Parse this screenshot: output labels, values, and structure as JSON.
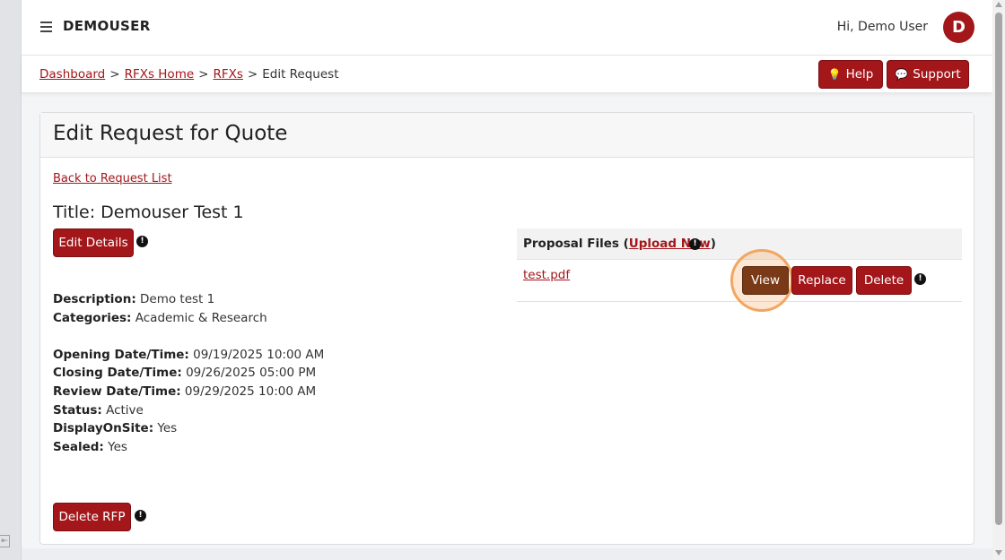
{
  "topbar": {
    "brand": "DEMOUSER",
    "greeting": "Hi, Demo User",
    "avatar_initial": "D"
  },
  "breadcrumb": {
    "items": [
      "Dashboard",
      "RFXs Home",
      "RFXs"
    ],
    "separator": ">",
    "current": "Edit Request"
  },
  "header_buttons": {
    "help_label": "Help",
    "support_label": "Support"
  },
  "card": {
    "title": "Edit Request for Quote",
    "back_link": "Back to Request List",
    "request_title": "Title: Demouser Test 1",
    "edit_details_label": "Edit Details",
    "delete_rfp_label": "Delete RFP"
  },
  "details": {
    "description_label": "Description:",
    "description": "Demo test 1",
    "categories_label": "Categories:",
    "categories": "Academic & Research",
    "opening_label": "Opening Date/Time:",
    "opening": "09/19/2025 10:00 AM",
    "closing_label": "Closing Date/Time:",
    "closing": "09/26/2025 05:00 PM",
    "review_label": "Review Date/Time:",
    "review": "09/29/2025 10:00 AM",
    "status_label": "Status:",
    "status": "Active",
    "display_label": "DisplayOnSite:",
    "display": "Yes",
    "sealed_label": "Sealed:",
    "sealed": "Yes"
  },
  "proposal_files": {
    "heading_prefix": "Proposal Files (",
    "upload_link": "Upload New",
    "heading_suffix": ")",
    "files": [
      {
        "name": "test.pdf",
        "view_label": "View",
        "replace_label": "Replace",
        "delete_label": "Delete"
      }
    ]
  },
  "icons": {
    "info": "!",
    "help": "💡",
    "support": "💬",
    "collapse": "⇤"
  },
  "colors": {
    "brand": "#a3161a",
    "focused_button": "#7a3a18",
    "focus_ring": "#f2a65f"
  }
}
